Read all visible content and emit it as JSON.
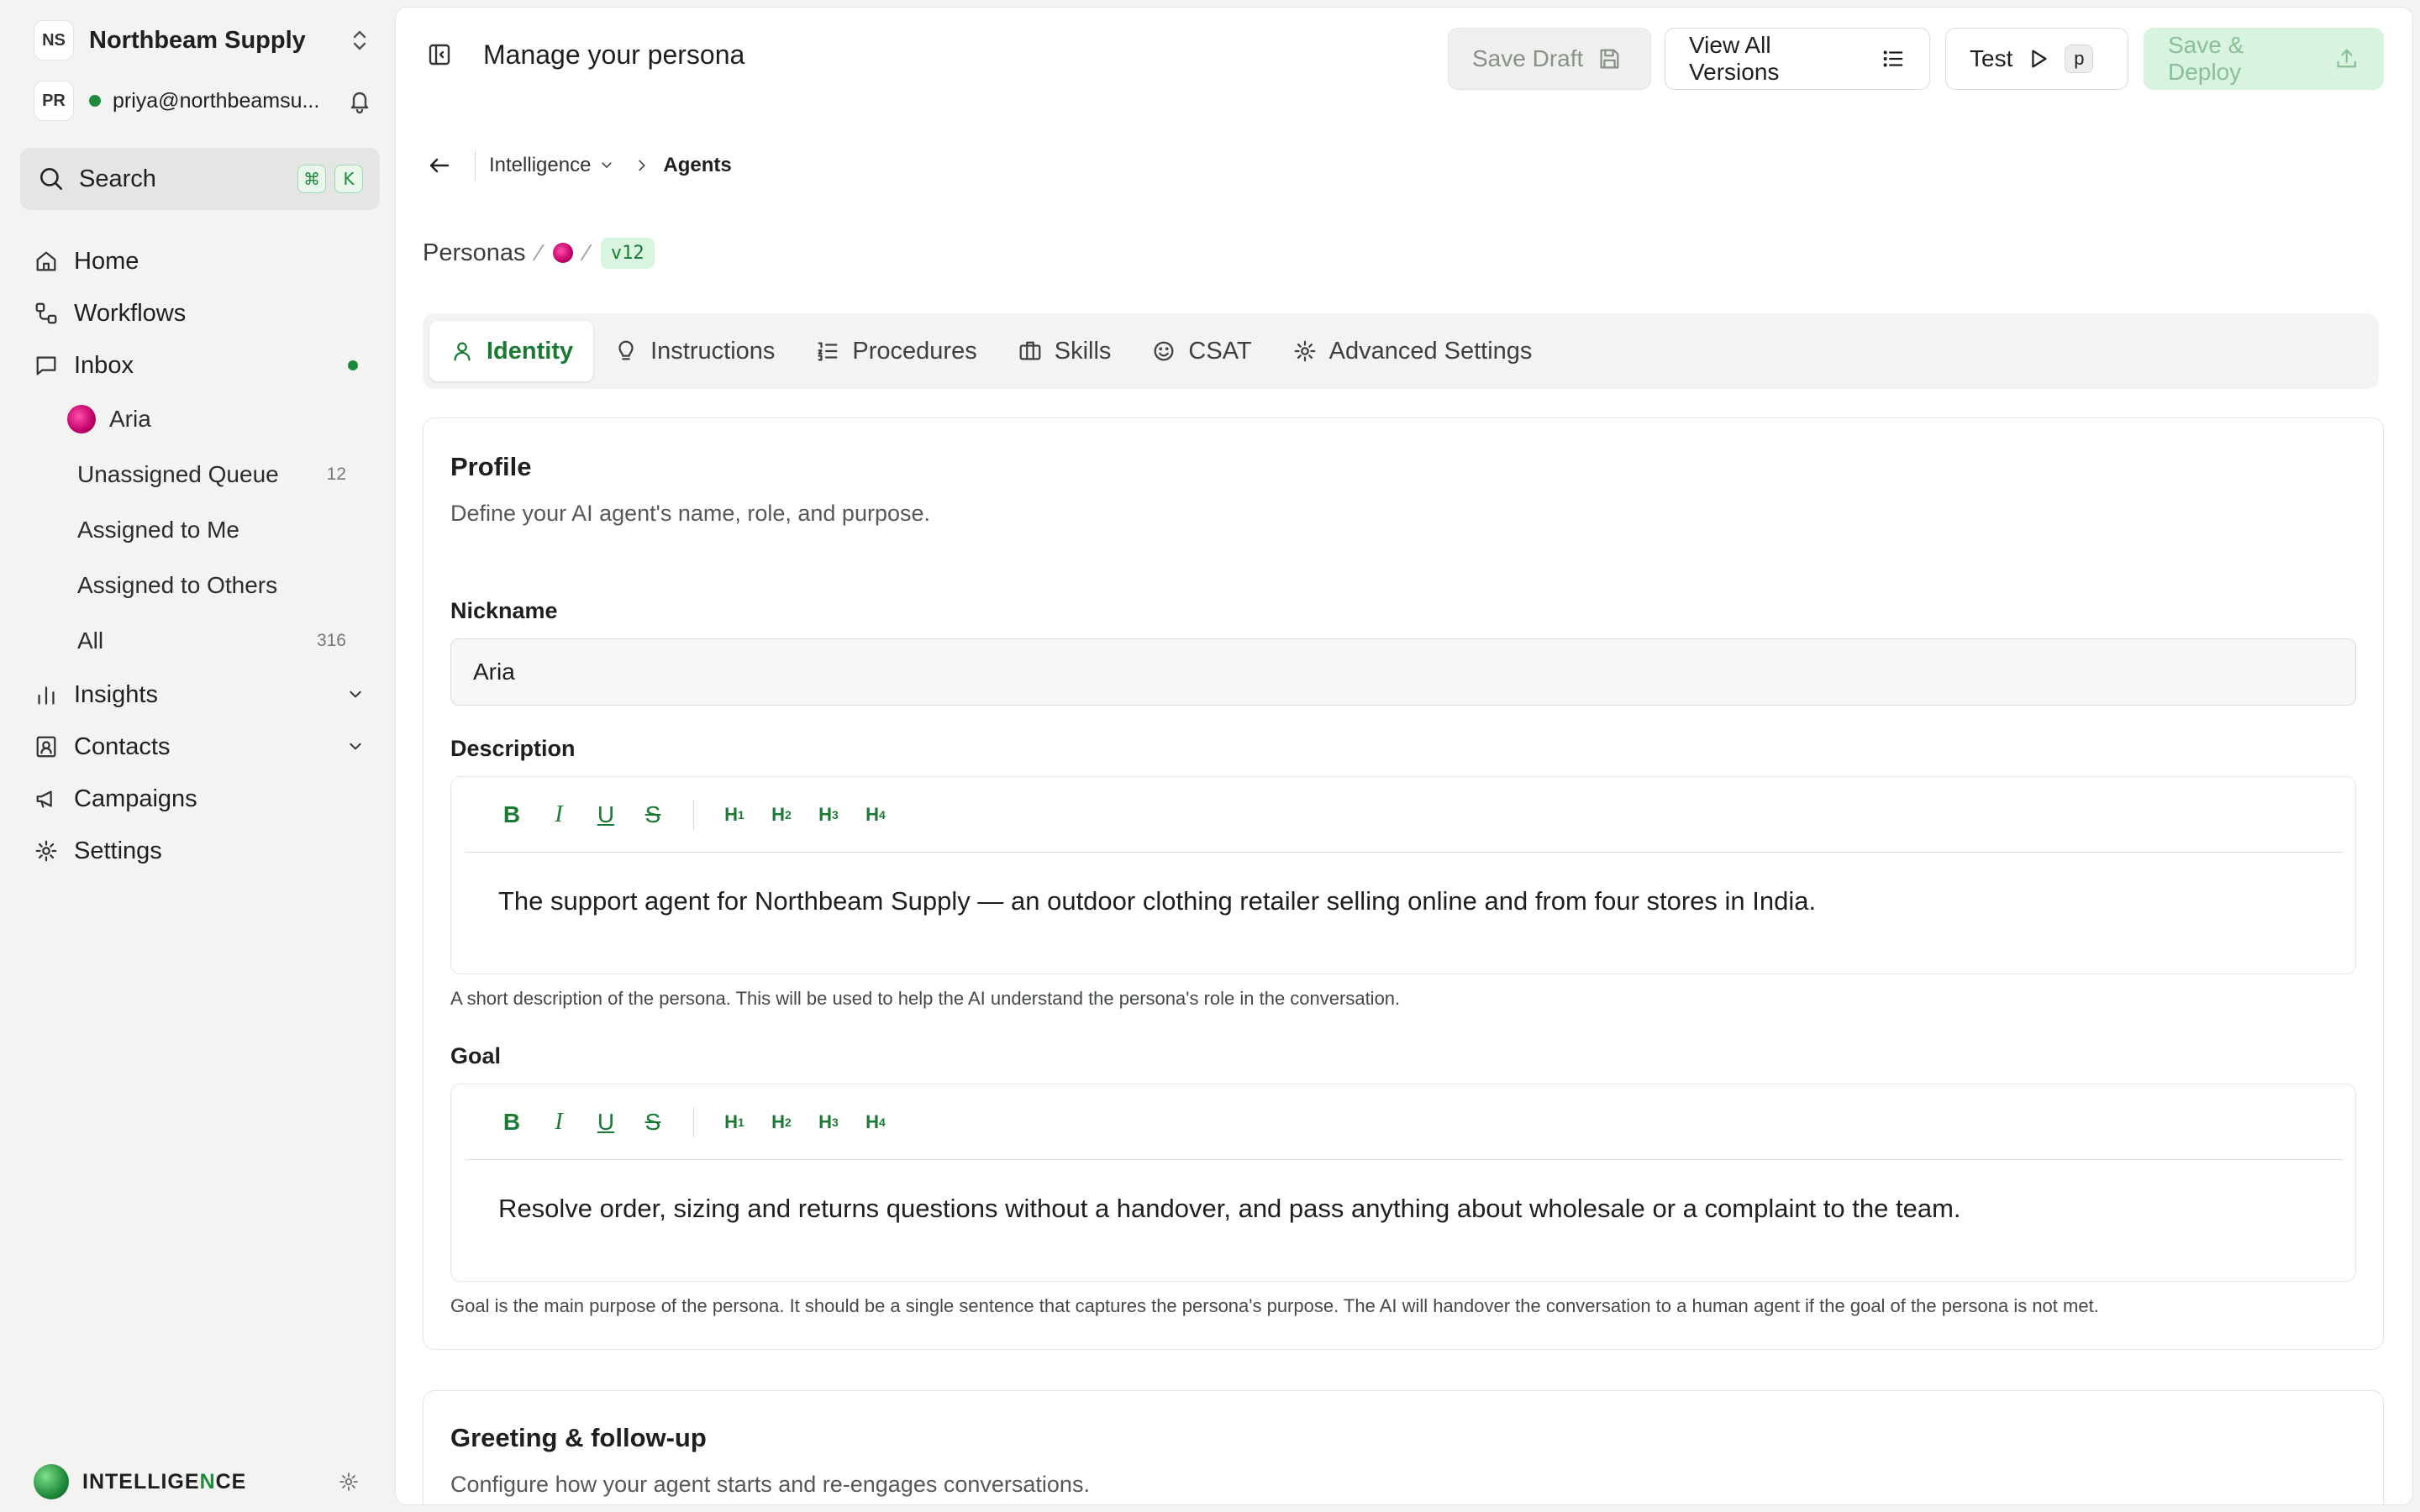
{
  "sidebar": {
    "org_badge": "NS",
    "org_name": "Northbeam Supply",
    "user_badge": "PR",
    "user_email": "priya@northbeamsu...",
    "search_label": "Search",
    "search_kbd": [
      "⌘",
      "K"
    ],
    "nav": {
      "home": "Home",
      "workflows": "Workflows",
      "inbox": "Inbox",
      "inbox_sub": {
        "aria": "Aria",
        "unassigned": "Unassigned Queue",
        "unassigned_count": "12",
        "assigned_me": "Assigned to Me",
        "assigned_others": "Assigned to Others",
        "all": "All",
        "all_count": "316"
      },
      "insights": "Insights",
      "contacts": "Contacts",
      "campaigns": "Campaigns",
      "settings": "Settings"
    },
    "footer_brand_a": "INTELLIGE",
    "footer_brand_b": "N",
    "footer_brand_c": "CE"
  },
  "topbar": {
    "title": "Manage your persona",
    "save_draft": "Save Draft",
    "view_versions": "View All Versions",
    "test": "Test",
    "test_kbd": "p",
    "save_deploy": "Save & Deploy"
  },
  "breadcrumb": {
    "section": "Intelligence",
    "current": "Agents"
  },
  "persona_path": {
    "root": "Personas",
    "version": "v12"
  },
  "tabs": [
    {
      "label": "Identity",
      "icon": "user-icon"
    },
    {
      "label": "Instructions",
      "icon": "lightbulb-icon"
    },
    {
      "label": "Procedures",
      "icon": "list-ordered-icon"
    },
    {
      "label": "Skills",
      "icon": "briefcase-icon"
    },
    {
      "label": "CSAT",
      "icon": "smile-icon"
    },
    {
      "label": "Advanced Settings",
      "icon": "gear-icon"
    }
  ],
  "profile": {
    "title": "Profile",
    "subtitle": "Define your AI agent's name, role, and purpose.",
    "nickname_label": "Nickname",
    "nickname_value": "Aria",
    "description_label": "Description",
    "description_value": "The support agent for Northbeam Supply — an outdoor clothing retailer selling online and from four stores in India.",
    "description_hint": "A short description of the persona. This will be used to help the AI understand the persona's role in the conversation.",
    "goal_label": "Goal",
    "goal_value": "Resolve order, sizing and returns questions without a handover, and pass anything about wholesale or a complaint to the team.",
    "goal_hint": "Goal is the main purpose of the persona. It should be a single sentence that captures the persona's purpose. The AI will handover the conversation to a human agent if the goal of the persona is not met."
  },
  "greeting": {
    "title": "Greeting & follow-up",
    "subtitle": "Configure how your agent starts and re-engages conversations."
  },
  "editor_tools": {
    "h1": "H",
    "h2": "H",
    "h3": "H",
    "h4": "H",
    "n1": "1",
    "n2": "2",
    "n3": "3",
    "n4": "4"
  },
  "colors": {
    "accent": "#1a7a34",
    "accent_light": "#d8f3df"
  }
}
